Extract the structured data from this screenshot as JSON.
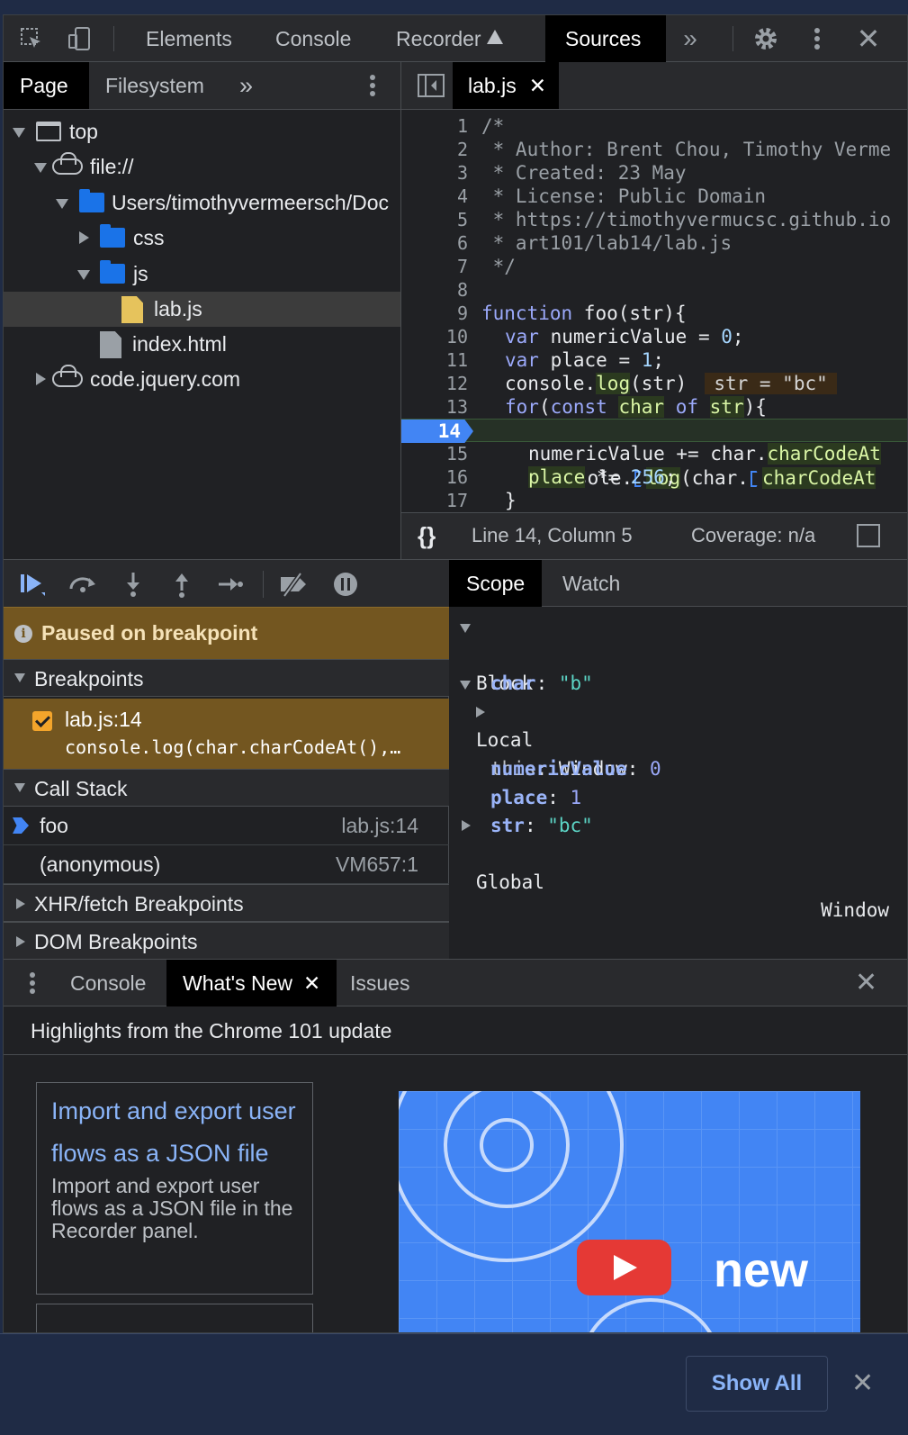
{
  "toolbar": {
    "tabs": [
      "Elements",
      "Console",
      "Recorder",
      "Sources"
    ],
    "active_tab": "Sources"
  },
  "navigator": {
    "tabs": [
      "Page",
      "Filesystem"
    ],
    "tree": [
      {
        "label": "top"
      },
      {
        "label": "file://"
      },
      {
        "label": "Users/timothyvermeersch/Doc"
      },
      {
        "label": "css"
      },
      {
        "label": "js"
      },
      {
        "label": "lab.js"
      },
      {
        "label": "index.html"
      },
      {
        "label": "code.jquery.com"
      }
    ]
  },
  "editor": {
    "file_tab": "lab.js",
    "line_numbers": [
      "1",
      "2",
      "3",
      "4",
      "5",
      "6",
      "7",
      "8",
      "9",
      "10",
      "11",
      "12",
      "13",
      "14",
      "15",
      "16",
      "17"
    ],
    "comment_lines": [
      "/*",
      " * Author: Brent Chou, Timothy Verme",
      " * Created: 23 May",
      " * License: Public Domain",
      " * https://timothyvermucsc.github.io",
      " * art101/lab14/lab.js",
      " */"
    ],
    "line9": {
      "kw": "function",
      "rest": " foo(str){"
    },
    "line10": {
      "kw": "var",
      "rest": " numericValue = ",
      "num": "0",
      "end": ";"
    },
    "line11": {
      "kw": "var",
      "rest": " place = ",
      "num": "1",
      "end": ";"
    },
    "line12": {
      "a": "console.",
      "hl": "log",
      "b": "(str)",
      "inline": "str = \"bc\""
    },
    "line13": {
      "kw1": "for",
      "a": "(",
      "kw2": "const",
      "sp": " ",
      "hl1": "char",
      "sp2": " ",
      "kw3": "of",
      "sp3": " ",
      "hl2": "str",
      "b": "){"
    },
    "line14": {
      "a": "console.",
      "b": "log",
      "c": "(char.",
      "d": "charCodeAt"
    },
    "line15": {
      "a": "numericValue += char.",
      "hl": "charCodeAt"
    },
    "line16": {
      "hl": "place",
      "a": " *= ",
      "num": "256",
      "b": ";"
    },
    "line17": "}",
    "status": {
      "position": "Line 14, Column 5",
      "coverage": "Coverage: n/a"
    }
  },
  "debugger": {
    "paused_message": "Paused on breakpoint",
    "sections": {
      "breakpoints": "Breakpoints",
      "call_stack": "Call Stack",
      "xhr": "XHR/fetch Breakpoints",
      "dom": "DOM Breakpoints"
    },
    "breakpoint_item": {
      "location": "lab.js:14",
      "code": "console.log(char.charCodeAt(),…"
    },
    "call_stack": [
      {
        "name": "foo",
        "location": "lab.js:14"
      },
      {
        "name": "(anonymous)",
        "location": "VM657:1"
      }
    ]
  },
  "scope": {
    "tabs": [
      "Scope",
      "Watch"
    ],
    "block_label": "Block",
    "local_label": "Local",
    "global_label": "Global",
    "global_value": "Window",
    "entries": {
      "char_key": "char",
      "char_val": "\"b\"",
      "this_key": "this",
      "this_val": "Window",
      "nv_key": "numericValue",
      "nv_val": "0",
      "place_key": "place",
      "place_val": "1",
      "str_key": "str",
      "str_val": "\"bc\""
    }
  },
  "drawer": {
    "tabs": [
      "Console",
      "What's New",
      "Issues"
    ],
    "highlights": "Highlights from the Chrome 101 update",
    "card_title": "Import and export user flows as a JSON file",
    "card_desc": "Import and export user flows as a JSON file in the Recorder panel.",
    "video_word": "new"
  },
  "notification": {
    "show_all": "Show All"
  }
}
